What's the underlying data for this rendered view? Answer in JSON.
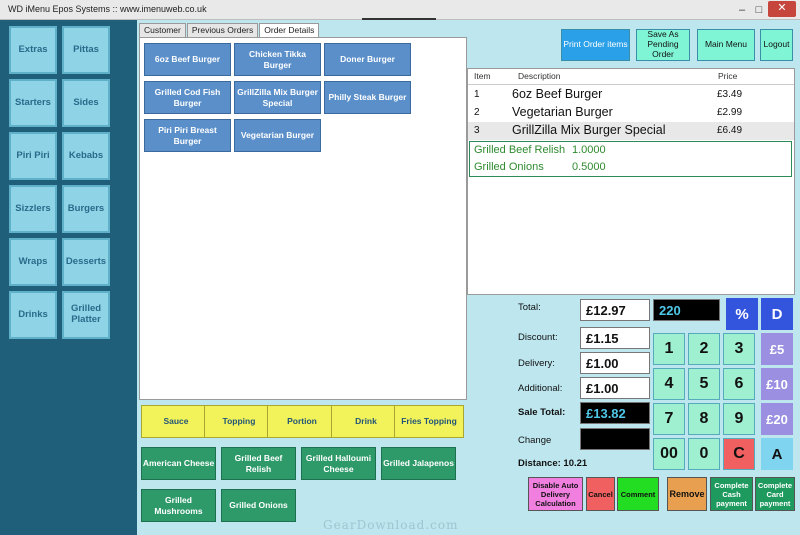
{
  "window": {
    "title": "WD iMenu Epos Systems :: www.imenuweb.co.uk"
  },
  "categories": [
    "Extras",
    "Pittas",
    "Starters",
    "Sides",
    "Piri Piri",
    "Kebabs",
    "Sizzlers",
    "Burgers",
    "Wraps",
    "Desserts",
    "Drinks",
    "Grilled Platter"
  ],
  "tabs": [
    "Customer",
    "Previous Orders",
    "Order Details"
  ],
  "items": [
    "6oz Beef Burger",
    "Chicken Tikka Burger",
    "Doner Burger",
    "Grilled Cod Fish Burger",
    "GrillZilla Mix Burger Special",
    "Philly Steak Burger",
    "Piri Piri Breast Burger",
    "Vegetarian Burger"
  ],
  "top_buttons": {
    "print": "Print Order items",
    "pending": "Save As Pending Order",
    "main_menu": "Main Menu",
    "logout": "Logout"
  },
  "order": {
    "headers": {
      "item": "Item",
      "description": "Description",
      "price": "Price"
    },
    "rows": [
      {
        "num": "1",
        "desc": "6oz Beef Burger",
        "price": "£3.49"
      },
      {
        "num": "2",
        "desc": "Vegetarian Burger",
        "price": "£2.99"
      },
      {
        "num": "3",
        "desc": "GrillZilla Mix Burger Special",
        "price": "£6.49"
      }
    ],
    "modifiers": [
      {
        "name": "Grilled Beef Relish",
        "qty": "1.0000"
      },
      {
        "name": "Grilled Onions",
        "qty": "0.5000"
      }
    ]
  },
  "totals": {
    "total_label": "Total:",
    "total": "£12.97",
    "discount_label": "Discount:",
    "discount": "£1.15",
    "delivery_label": "Delivery:",
    "delivery": "£1.00",
    "additional_label": "Additional:",
    "additional": "£1.00",
    "sale_total_label": "Sale Total:",
    "sale_total": "£13.82",
    "change_label": "Change",
    "change": "",
    "distance_label": "Distance:",
    "distance": "10.21",
    "entry": "220"
  },
  "keypad": [
    "1",
    "2",
    "3",
    "4",
    "5",
    "6",
    "7",
    "8",
    "9",
    "00",
    "0",
    "C"
  ],
  "side_keys": [
    "%",
    "D",
    "£5",
    "£10",
    "£20",
    "A"
  ],
  "modifier_buttons": [
    "Sauce",
    "Topping",
    "Portion",
    "Drink",
    "Fries Topping"
  ],
  "addons": [
    "American Cheese",
    "Grilled Beef Relish",
    "Grilled Halloumi Cheese",
    "Grilled Jalapenos",
    "Grilled Mushrooms",
    "Grilled Onions"
  ],
  "actions": {
    "disable_auto": "Disable Auto Delivery Calculation",
    "cancel": "Cancel",
    "comment": "Comment",
    "remove": "Remove",
    "cash": "Complete Cash payment",
    "card": "Complete Card payment"
  },
  "watermark": "GearDownload.com",
  "colors": {
    "category": "#8fd3e6",
    "item": "#5b8fc9",
    "modifier": "#f2f25a",
    "addon": "#2e9a6a",
    "keypad": "#9ff0d0"
  }
}
